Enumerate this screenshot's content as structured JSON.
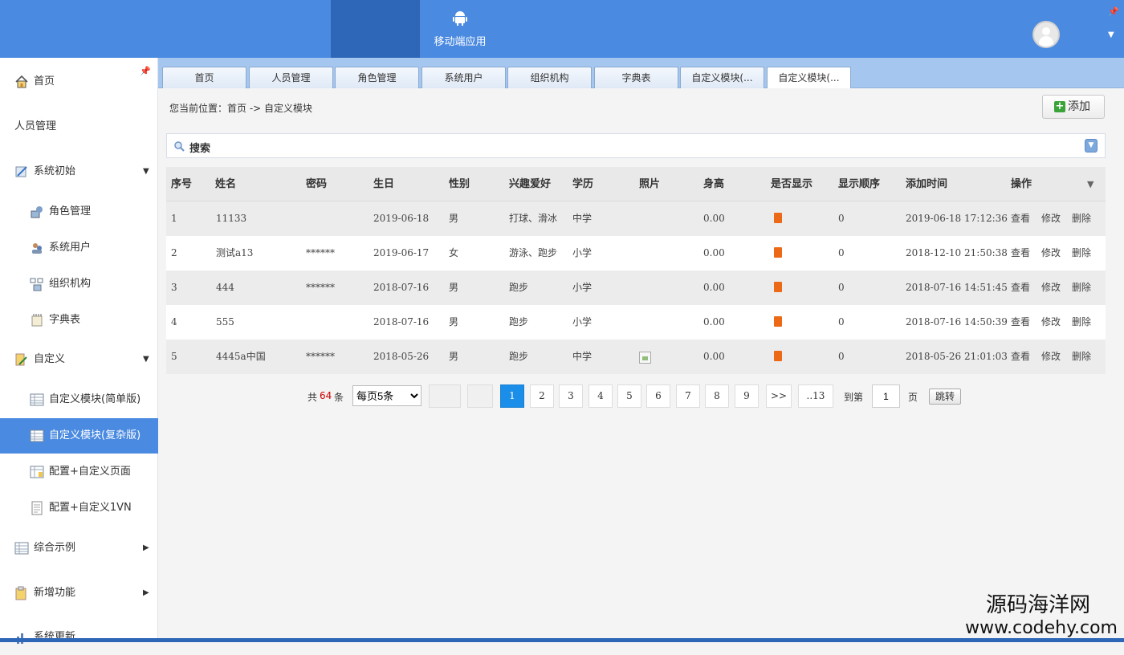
{
  "topbar": {
    "app_label": "移动端应用",
    "pin_icon": "pin-icon",
    "user_icon": "user-avatar-icon"
  },
  "sidebar": {
    "items": [
      {
        "label": "首页",
        "icon": "home-icon"
      },
      {
        "label": "人员管理",
        "icon": ""
      },
      {
        "label": "系统初始",
        "icon": "system-init-icon"
      },
      {
        "label": "角色管理",
        "icon": "role-icon"
      },
      {
        "label": "系统用户",
        "icon": "system-user-icon"
      },
      {
        "label": "组织机构",
        "icon": "org-icon"
      },
      {
        "label": "字典表",
        "icon": "dictionary-icon"
      },
      {
        "label": "自定义",
        "icon": "custom-icon"
      },
      {
        "label": "自定义模块(简单版)",
        "icon": "table-icon"
      },
      {
        "label": "自定义模块(复杂版)",
        "icon": "table-icon"
      },
      {
        "label": "配置+自定义页面",
        "icon": "config-page-icon"
      },
      {
        "label": "配置+自定义1VN",
        "icon": "config-doc-icon"
      },
      {
        "label": "综合示例",
        "icon": "examples-icon"
      },
      {
        "label": "新增功能",
        "icon": "new-features-icon"
      },
      {
        "label": "系统更新",
        "icon": "chart-icon"
      }
    ]
  },
  "tabs": [
    "首页",
    "人员管理",
    "角色管理",
    "系统用户",
    "组织机构",
    "字典表",
    "自定义模块(...",
    "自定义模块(..."
  ],
  "breadcrumb": "您当前位置：首页 -> 自定义模块",
  "add_button": "添加",
  "search_label": "搜索",
  "table": {
    "columns": [
      "序号",
      "姓名",
      "密码",
      "生日",
      "性别",
      "兴趣爱好",
      "学历",
      "照片",
      "身高",
      "是否显示",
      "显示顺序",
      "添加时间",
      "操作"
    ],
    "rows": [
      {
        "no": "1",
        "name": "11133",
        "password": "",
        "birthday": "2019-06-18",
        "gender": "男",
        "hobby": "打球、滑冰",
        "edu": "中学",
        "photo": false,
        "height": "0.00",
        "order": "0",
        "added": "2019-06-18 17:12:36"
      },
      {
        "no": "2",
        "name": "测试a13",
        "password": "******",
        "birthday": "2019-06-17",
        "gender": "女",
        "hobby": "游泳、跑步",
        "edu": "小学",
        "photo": false,
        "height": "0.00",
        "order": "0",
        "added": "2018-12-10 21:50:38"
      },
      {
        "no": "3",
        "name": "444",
        "password": "******",
        "birthday": "2018-07-16",
        "gender": "男",
        "hobby": "跑步",
        "edu": "小学",
        "photo": false,
        "height": "0.00",
        "order": "0",
        "added": "2018-07-16 14:51:45"
      },
      {
        "no": "4",
        "name": "555",
        "password": "",
        "birthday": "2018-07-16",
        "gender": "男",
        "hobby": "跑步",
        "edu": "小学",
        "photo": false,
        "height": "0.00",
        "order": "0",
        "added": "2018-07-16 14:50:39"
      },
      {
        "no": "5",
        "name": "4445a中国",
        "password": "******",
        "birthday": "2018-05-26",
        "gender": "男",
        "hobby": "跑步",
        "edu": "中学",
        "photo": true,
        "height": "0.00",
        "order": "0",
        "added": "2018-05-26 21:01:03"
      }
    ],
    "actions": [
      "查看",
      "修改",
      "删除"
    ],
    "show_flag_color": "#ec6a17"
  },
  "pager": {
    "total_prefix": "共",
    "total": "64",
    "total_suffix": "条",
    "page_size": "每页5条",
    "pages": [
      "1",
      "2",
      "3",
      "4",
      "5",
      "6",
      "7",
      "8",
      "9"
    ],
    "current": "1",
    "next_label": ">>",
    "last_label": "..13",
    "goto_prefix": "到第",
    "goto_value": "1",
    "goto_suffix": "页",
    "jump_label": "跳转"
  },
  "watermark": {
    "line1": "源码海洋网",
    "line2": "www.codehy.com"
  },
  "colors": {
    "accent": "#4a8ae0",
    "active_page": "#1a8ee8",
    "link": "#2f6fb6"
  }
}
